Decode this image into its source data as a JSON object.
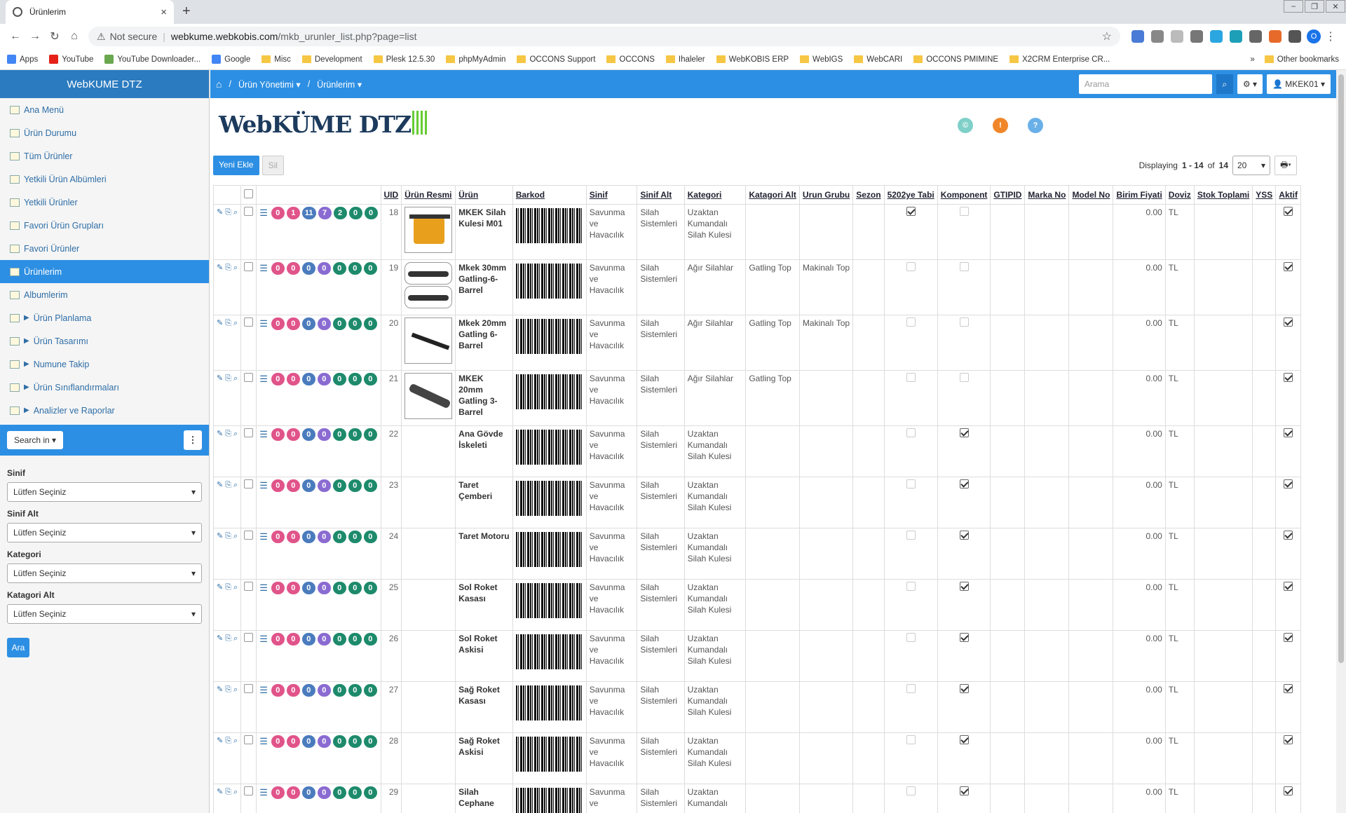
{
  "browser": {
    "tab_title": "Ürünlerim",
    "new_tab": "+",
    "security_label": "Not secure",
    "url_host": "webkume.webkobis.com",
    "url_path": "/mkb_urunler_list.php?page=list",
    "profile_initial": "O",
    "bookmarks": [
      "Apps",
      "YouTube",
      "YouTube Downloader...",
      "Google",
      "Misc",
      "Development",
      "Plesk 12.5.30",
      "phpMyAdmin",
      "OCCONS Support",
      "OCCONS",
      "Ihaleler",
      "WebKOBIS ERP",
      "WebIGS",
      "WebCARI",
      "OCCONS PMIMINE",
      "X2CRM Enterprise CR..."
    ],
    "bookmarks_more": "»",
    "other_bookmarks": "Other bookmarks"
  },
  "sidebar": {
    "title": "WebKUME DTZ",
    "items": [
      {
        "label": "Ana Menü"
      },
      {
        "label": "Ürün Durumu"
      },
      {
        "label": "Tüm Ürünler"
      },
      {
        "label": "Yetkili Ürün Albümleri"
      },
      {
        "label": "Yetkili Ürünler"
      },
      {
        "label": "Favori Ürün Grupları"
      },
      {
        "label": "Favori Ürünler"
      },
      {
        "label": "Ürünlerim"
      },
      {
        "label": "Albumlerim"
      },
      {
        "label": "Ürün Planlama"
      },
      {
        "label": "Ürün Tasarımı"
      },
      {
        "label": "Numune Takip"
      },
      {
        "label": "Ürün Sınıflandırmaları"
      },
      {
        "label": "Analizler ve Raporlar"
      }
    ],
    "search_in": "Search in",
    "kebab": "⋮",
    "filters": [
      {
        "label": "Sinif",
        "value": "Lütfen Seçiniz"
      },
      {
        "label": "Sinif Alt",
        "value": "Lütfen Seçiniz"
      },
      {
        "label": "Kategori",
        "value": "Lütfen Seçiniz"
      },
      {
        "label": "Katagori Alt",
        "value": "Lütfen Seçiniz"
      }
    ],
    "search_button": "Ara"
  },
  "topnav": {
    "crumb1": "Ürün Yönetimi",
    "crumb2": "Ürünlerim",
    "search_placeholder": "Arama",
    "user": "MKEK01"
  },
  "logo": "WebKÜME DTZ",
  "status_circles": [
    {
      "symbol": "©",
      "color": "#7fd0c8"
    },
    {
      "symbol": "!",
      "color": "#f0862a"
    },
    {
      "symbol": "?",
      "color": "#6ab0e8"
    }
  ],
  "toolbar": {
    "add": "Yeni Ekle",
    "delete": "Sil",
    "displaying_prefix": "Displaying",
    "range": "1 - 14",
    "of": "of",
    "total": "14",
    "page_size": "20"
  },
  "table": {
    "columns": [
      "UID",
      "Ürün Resmi",
      "Ürün",
      "Barkod",
      "Sinif",
      "Sinif Alt",
      "Kategori",
      "Katagori Alt",
      "Urun Grubu",
      "Sezon",
      "5202ye Tabi",
      "Komponent",
      "GTIPID",
      "Marka No",
      "Model No",
      "Birim Fiyati",
      "Doviz",
      "Stok Toplami",
      "YSS",
      "Aktif"
    ],
    "rows": [
      {
        "uid": "18",
        "name": "MKEK Silah Kulesi M01",
        "img": "a",
        "badges": [
          "0",
          "1",
          "11",
          "7",
          "2",
          "0",
          "0"
        ],
        "sinif": "Savunma ve Havacılık",
        "sinif_alt": "Silah Sistemleri",
        "kategori": "Uzaktan Kumandalı Silah Kulesi",
        "kat_alt": "",
        "grup": "",
        "tabi": true,
        "komp": false,
        "fiyat": "0.00",
        "doviz": "TL",
        "aktif": true
      },
      {
        "uid": "19",
        "name": "Mkek 30mm Gatling-6-Barrel",
        "img": "b",
        "badges": [
          "0",
          "0",
          "0",
          "0",
          "0",
          "0",
          "0"
        ],
        "sinif": "Savunma ve Havacılık",
        "sinif_alt": "Silah Sistemleri",
        "kategori": "Ağır Silahlar",
        "kat_alt": "Gatling Top",
        "grup": "Makinalı Top",
        "tabi": false,
        "komp": false,
        "fiyat": "0.00",
        "doviz": "TL",
        "aktif": true
      },
      {
        "uid": "20",
        "name": "Mkek 20mm Gatling 6-Barrel",
        "img": "c",
        "badges": [
          "0",
          "0",
          "0",
          "0",
          "0",
          "0",
          "0"
        ],
        "sinif": "Savunma ve Havacılık",
        "sinif_alt": "Silah Sistemleri",
        "kategori": "Ağır Silahlar",
        "kat_alt": "Gatling Top",
        "grup": "Makinalı Top",
        "tabi": false,
        "komp": false,
        "fiyat": "0.00",
        "doviz": "TL",
        "aktif": true
      },
      {
        "uid": "21",
        "name": "MKEK 20mm Gatling 3-Barrel",
        "img": "d",
        "badges": [
          "0",
          "0",
          "0",
          "0",
          "0",
          "0",
          "0"
        ],
        "sinif": "Savunma ve Havacılık",
        "sinif_alt": "Silah Sistemleri",
        "kategori": "Ağır Silahlar",
        "kat_alt": "Gatling Top",
        "grup": "",
        "tabi": false,
        "komp": false,
        "fiyat": "0.00",
        "doviz": "TL",
        "aktif": true
      },
      {
        "uid": "22",
        "name": "Ana Gövde İskeleti",
        "img": "",
        "badges": [
          "0",
          "0",
          "0",
          "0",
          "0",
          "0",
          "0"
        ],
        "sinif": "Savunma ve Havacılık",
        "sinif_alt": "Silah Sistemleri",
        "kategori": "Uzaktan Kumandalı Silah Kulesi",
        "kat_alt": "",
        "grup": "",
        "tabi": false,
        "komp": true,
        "fiyat": "0.00",
        "doviz": "TL",
        "aktif": true
      },
      {
        "uid": "23",
        "name": "Taret Çemberi",
        "img": "",
        "badges": [
          "0",
          "0",
          "0",
          "0",
          "0",
          "0",
          "0"
        ],
        "sinif": "Savunma ve Havacılık",
        "sinif_alt": "Silah Sistemleri",
        "kategori": "Uzaktan Kumandalı Silah Kulesi",
        "kat_alt": "",
        "grup": "",
        "tabi": false,
        "komp": true,
        "fiyat": "0.00",
        "doviz": "TL",
        "aktif": true
      },
      {
        "uid": "24",
        "name": "Taret Motoru",
        "img": "",
        "badges": [
          "0",
          "0",
          "0",
          "0",
          "0",
          "0",
          "0"
        ],
        "sinif": "Savunma ve Havacılık",
        "sinif_alt": "Silah Sistemleri",
        "kategori": "Uzaktan Kumandalı Silah Kulesi",
        "kat_alt": "",
        "grup": "",
        "tabi": false,
        "komp": true,
        "fiyat": "0.00",
        "doviz": "TL",
        "aktif": true
      },
      {
        "uid": "25",
        "name": "Sol Roket Kasası",
        "img": "",
        "badges": [
          "0",
          "0",
          "0",
          "0",
          "0",
          "0",
          "0"
        ],
        "sinif": "Savunma ve Havacılık",
        "sinif_alt": "Silah Sistemleri",
        "kategori": "Uzaktan Kumandalı Silah Kulesi",
        "kat_alt": "",
        "grup": "",
        "tabi": false,
        "komp": true,
        "fiyat": "0.00",
        "doviz": "TL",
        "aktif": true
      },
      {
        "uid": "26",
        "name": "Sol Roket Askisi",
        "img": "",
        "badges": [
          "0",
          "0",
          "0",
          "0",
          "0",
          "0",
          "0"
        ],
        "sinif": "Savunma ve Havacılık",
        "sinif_alt": "Silah Sistemleri",
        "kategori": "Uzaktan Kumandalı Silah Kulesi",
        "kat_alt": "",
        "grup": "",
        "tabi": false,
        "komp": true,
        "fiyat": "0.00",
        "doviz": "TL",
        "aktif": true
      },
      {
        "uid": "27",
        "name": "Sağ Roket Kasası",
        "img": "",
        "badges": [
          "0",
          "0",
          "0",
          "0",
          "0",
          "0",
          "0"
        ],
        "sinif": "Savunma ve Havacılık",
        "sinif_alt": "Silah Sistemleri",
        "kategori": "Uzaktan Kumandalı Silah Kulesi",
        "kat_alt": "",
        "grup": "",
        "tabi": false,
        "komp": true,
        "fiyat": "0.00",
        "doviz": "TL",
        "aktif": true
      },
      {
        "uid": "28",
        "name": "Sağ Roket Askisi",
        "img": "",
        "badges": [
          "0",
          "0",
          "0",
          "0",
          "0",
          "0",
          "0"
        ],
        "sinif": "Savunma ve Havacılık",
        "sinif_alt": "Silah Sistemleri",
        "kategori": "Uzaktan Kumandalı Silah Kulesi",
        "kat_alt": "",
        "grup": "",
        "tabi": false,
        "komp": true,
        "fiyat": "0.00",
        "doviz": "TL",
        "aktif": true
      },
      {
        "uid": "29",
        "name": "Silah Cephane",
        "img": "",
        "badges": [
          "0",
          "0",
          "0",
          "0",
          "0",
          "0",
          "0"
        ],
        "sinif": "Savunma ve",
        "sinif_alt": "Silah Sistemleri",
        "kategori": "Uzaktan Kumandalı",
        "kat_alt": "",
        "grup": "",
        "tabi": false,
        "komp": true,
        "fiyat": "0.00",
        "doviz": "TL",
        "aktif": true
      }
    ]
  }
}
